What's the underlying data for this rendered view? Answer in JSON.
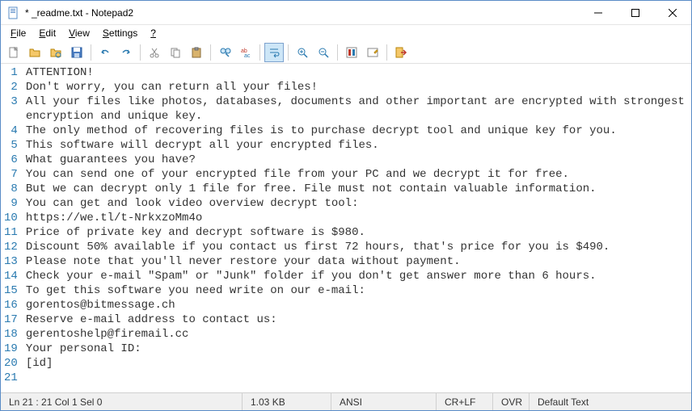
{
  "window": {
    "title": "* _readme.txt - Notepad2"
  },
  "menu": {
    "file": "File",
    "edit": "Edit",
    "view": "View",
    "settings": "Settings",
    "help": "?"
  },
  "toolbar_icons": {
    "new": "new-file-icon",
    "open": "open-folder-icon",
    "browse": "browse-folder-icon",
    "save": "save-icon",
    "undo": "undo-icon",
    "redo": "redo-icon",
    "cut": "cut-icon",
    "copy": "copy-icon",
    "paste": "paste-icon",
    "find": "find-icon",
    "replace": "replace-icon",
    "wordwrap": "word-wrap-icon",
    "zoomin": "zoom-in-icon",
    "zoomout": "zoom-out-icon",
    "scheme": "scheme-icon",
    "customize": "customize-icon",
    "exit": "exit-icon"
  },
  "content": {
    "lines": [
      "ATTENTION!",
      "Don't worry, you can return all your files!",
      "All your files like photos, databases, documents and other important are encrypted with strongest encryption and unique key.",
      "The only method of recovering files is to purchase decrypt tool and unique key for you.",
      "This software will decrypt all your encrypted files.",
      "What guarantees you have?",
      "You can send one of your encrypted file from your PC and we decrypt it for free.",
      "But we can decrypt only 1 file for free. File must not contain valuable information.",
      "You can get and look video overview decrypt tool:",
      "https://we.tl/t-NrkxzoMm4o",
      "Price of private key and decrypt software is $980.",
      "Discount 50% available if you contact us first 72 hours, that's price for you is $490.",
      "Please note that you'll never restore your data without payment.",
      "Check your e-mail \"Spam\" or \"Junk\" folder if you don't get answer more than 6 hours.",
      "To get this software you need write on our e-mail:",
      "gorentos@bitmessage.ch",
      "Reserve e-mail address to contact us:",
      "gerentoshelp@firemail.cc",
      "Your personal ID:",
      "[id]",
      ""
    ]
  },
  "status": {
    "pos": "Ln 21 : 21   Col 1   Sel 0",
    "size": "1.03 KB",
    "encoding": "ANSI",
    "eol": "CR+LF",
    "ovr": "OVR",
    "scheme": "Default Text"
  }
}
